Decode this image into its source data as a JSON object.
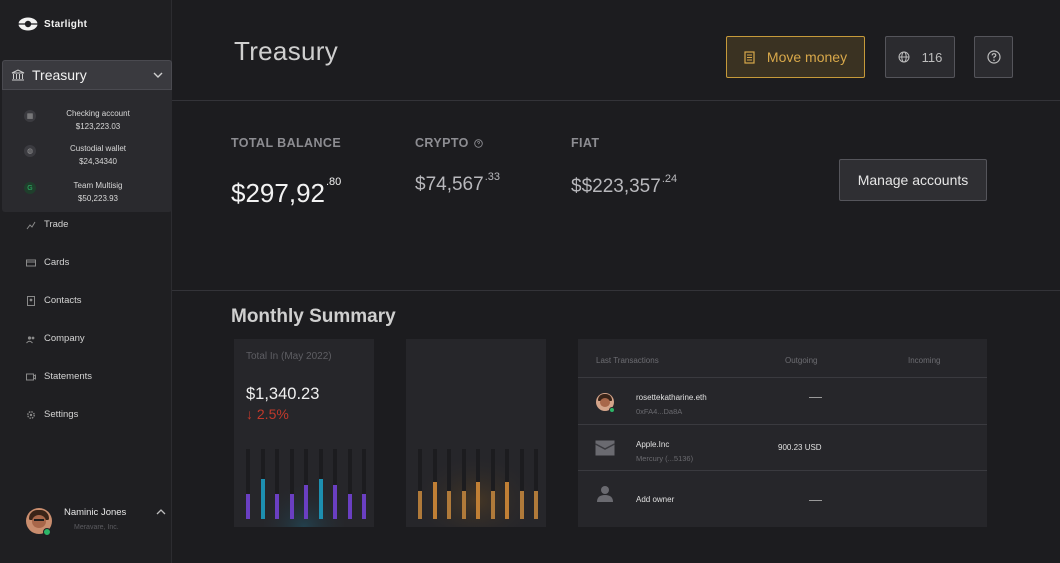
{
  "brand": {
    "name": "Starlight"
  },
  "sidebar": {
    "treasury_label": "Treasury",
    "accounts": [
      {
        "name": "Checking account",
        "amount": "$123,223.03"
      },
      {
        "name": "Custodial wallet",
        "amount": "$24,34340"
      },
      {
        "name": "Team Multisig",
        "amount": "$50,223.93"
      }
    ],
    "items": [
      {
        "label": "Trade",
        "icon": "trend-chart-icon"
      },
      {
        "label": "Cards",
        "icon": "card-icon"
      },
      {
        "label": "Contacts",
        "icon": "contacts-icon"
      },
      {
        "label": "Company",
        "icon": "company-icon"
      },
      {
        "label": "Statements",
        "icon": "statements-icon"
      },
      {
        "label": "Settings",
        "icon": "gear-icon"
      }
    ],
    "user": {
      "name": "Naminic Jones",
      "org": "Meravare, Inc."
    }
  },
  "header": {
    "title": "Treasury",
    "move_money_label": "Move money",
    "count_label": "116"
  },
  "balances": {
    "total": {
      "label": "TOTAL BALANCE",
      "whole": "$297,92",
      "cents": ".80"
    },
    "crypto": {
      "label": "CRYPTO",
      "whole": "$74,567",
      "cents": ".33"
    },
    "fiat": {
      "label": "FIAT",
      "whole": "$$223,357",
      "cents": ".24"
    },
    "manage_label": "Manage accounts"
  },
  "summary": {
    "title": "Monthly Summary",
    "total_in_label": "Total In (May 2022)",
    "total_in_amount": "$1,340.23",
    "change": "↓ 2.5%"
  },
  "transactions": {
    "headers": {
      "last": "Last Transactions",
      "outgoing": "Outgoing",
      "incoming": "Incoming"
    },
    "rows": [
      {
        "name": "rosettekatharine.eth",
        "sub": "0xFA4...Da8A",
        "outgoing": "",
        "icon": "avatar"
      },
      {
        "name": "Apple.Inc",
        "sub": "Mercury (...5136)",
        "outgoing": "900.23 USD",
        "icon": "bank-card-icon"
      },
      {
        "name": "Add owner",
        "sub": "",
        "outgoing": "",
        "icon": "person-icon"
      }
    ]
  },
  "colors": {
    "accent": "#c69a3a",
    "negative": "#c0392b",
    "online": "#2db567"
  }
}
